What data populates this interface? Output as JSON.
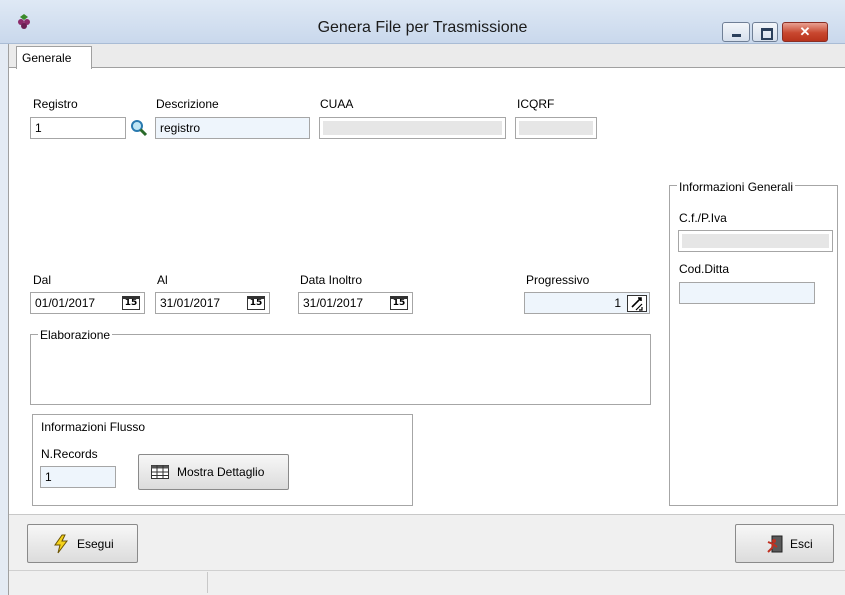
{
  "window": {
    "title": "Genera File per Trasmissione"
  },
  "tabs": [
    {
      "label": "Generale",
      "active": true
    }
  ],
  "registro": {
    "label": "Registro",
    "value": "1",
    "lookup_icon": "magnifier-icon"
  },
  "descrizione": {
    "label": "Descrizione",
    "value": "registro"
  },
  "cuaa": {
    "label": "CUAA",
    "value": ""
  },
  "icqrf": {
    "label": "ICQRF",
    "value": ""
  },
  "dal": {
    "label": "Dal",
    "value": "01/01/2017",
    "calendar_icon_text": "15"
  },
  "al": {
    "label": "Al",
    "value": "31/01/2017",
    "calendar_icon_text": "15"
  },
  "data_inoltro": {
    "label": "Data Inoltro",
    "value": "31/01/2017",
    "calendar_icon_text": "15"
  },
  "progressivo": {
    "label": "Progressivo",
    "value": "1",
    "spinner_icon": "spin-arrows-icon"
  },
  "elaborazione": {
    "title": "Elaborazione"
  },
  "informazioni_flusso": {
    "title": "Informazioni Flusso",
    "n_records_label": "N.Records",
    "n_records_value": "1",
    "mostra_dettaglio_label": "Mostra Dettaglio",
    "mostra_dettaglio_icon": "grid-icon"
  },
  "informazioni_generali": {
    "title": "Informazioni Generali",
    "cf_piva_label": "C.f./P.Iva",
    "cf_piva_value": "",
    "cod_ditta_label": "Cod.Ditta",
    "cod_ditta_value": ""
  },
  "toolbar": {
    "esegui_label": "Esegui",
    "esegui_icon": "lightning-icon",
    "esci_label": "Esci",
    "esci_icon": "exit-door-icon"
  },
  "colors": {
    "titlebar": "#c9d8ec",
    "input_blue": "#eef5fc",
    "close_button": "#c8472f"
  }
}
